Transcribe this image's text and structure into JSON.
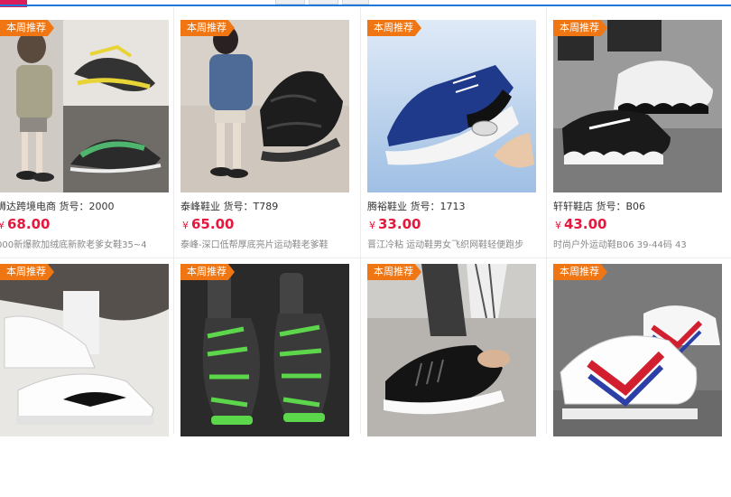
{
  "badge_label": "本周推荐",
  "currency_symbol": "¥",
  "colors": {
    "badge": "#f07613",
    "price": "#e5183d",
    "top_accent": "#d81e5b",
    "top_line": "#1e78d6"
  },
  "products": [
    {
      "shop": "狮达跨境电商 货号：2000",
      "price": "68.00",
      "desc": "000新爆款加绒底新款老爹女鞋35~4",
      "image": "woman-in-jacket-with-chunky-sneakers-collage"
    },
    {
      "shop": "泰峰鞋业 货号：T789",
      "price": "65.00",
      "desc": "泰峰-深口低帮厚底亮片运动鞋老爹鞋",
      "image": "black-chunky-sneakers"
    },
    {
      "shop": "腾裕鞋业 货号：1713",
      "price": "33.00",
      "desc": "晋江冷粘 运动鞋男女飞织网鞋轻便跑步",
      "image": "blue-air-cushion-running-shoe"
    },
    {
      "shop": "轩轩鞋店 货号：B06",
      "price": "43.00",
      "desc": "时尚户外运动鞋B06 39-44码 43",
      "image": "black-white-wavy-sole-sneakers"
    },
    {
      "image": "white-low-top-sneakers-black-swoosh"
    },
    {
      "image": "black-green-knit-sneakers"
    },
    {
      "image": "black-slip-on-knit-shoes"
    },
    {
      "image": "white-red-blue-stripe-sneakers"
    }
  ]
}
